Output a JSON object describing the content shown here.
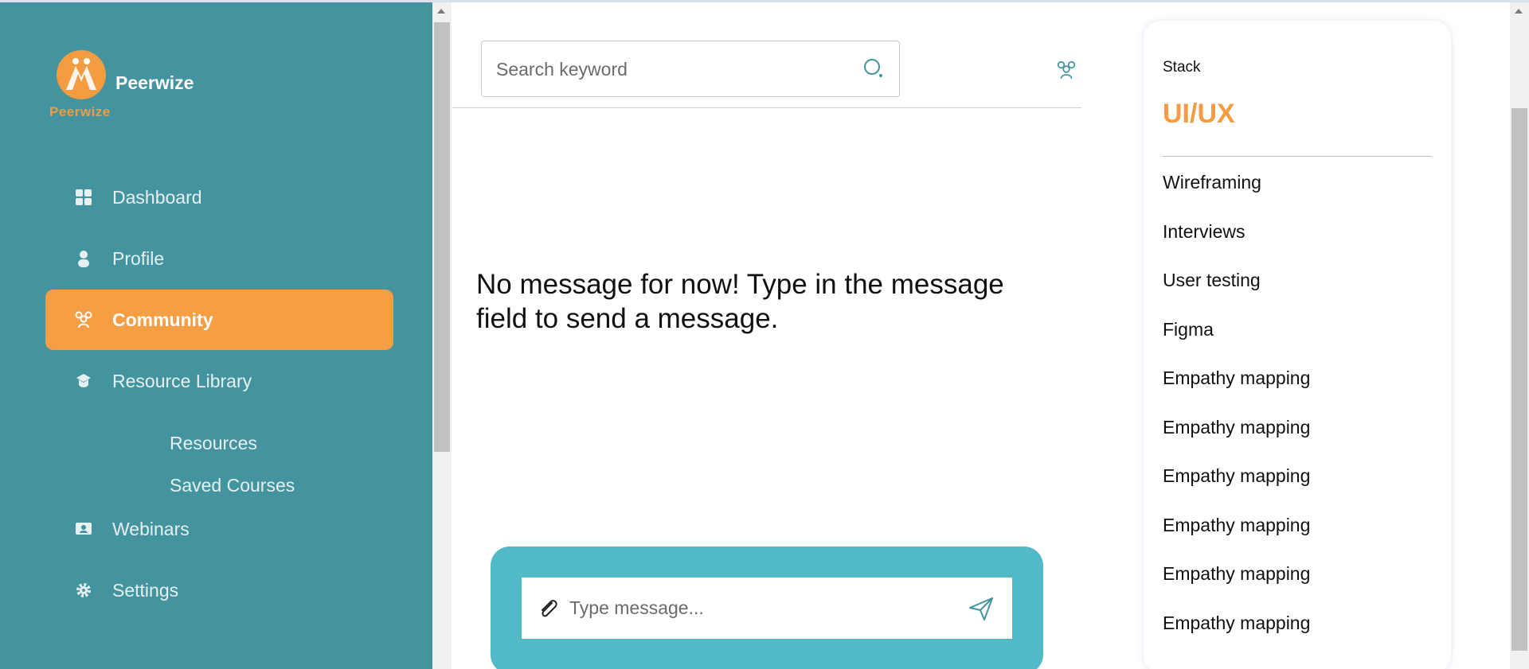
{
  "brand": {
    "name": "Peerwize",
    "logo_text": "Peerwize"
  },
  "sidebar": {
    "items": [
      {
        "label": "Dashboard",
        "icon": "grid-icon",
        "active": false
      },
      {
        "label": "Profile",
        "icon": "user-icon",
        "active": false
      },
      {
        "label": "Community",
        "icon": "group-icon",
        "active": true
      },
      {
        "label": "Resource Library",
        "icon": "graduation-cap-icon",
        "active": false
      },
      {
        "label": "Webinars",
        "icon": "monitor-user-icon",
        "active": false
      },
      {
        "label": "Settings",
        "icon": "gear-icon",
        "active": false
      }
    ],
    "subitems": [
      {
        "label": "Resources"
      },
      {
        "label": "Saved Courses"
      }
    ]
  },
  "chat": {
    "search_placeholder": "Search keyword",
    "empty_message": "No message for now! Type in the message field to send a message.",
    "message_placeholder": "Type message..."
  },
  "stack": {
    "label": "Stack",
    "title": "UI/UX",
    "topics": [
      "Wireframing",
      "Interviews",
      "User testing",
      "Figma",
      "Empathy mapping",
      "Empathy mapping",
      "Empathy mapping",
      "Empathy mapping",
      "Empathy mapping",
      "Empathy mapping"
    ]
  },
  "colors": {
    "sidebar_bg": "#43949f",
    "accent": "#f59e44",
    "composer_bg": "#52b9c6"
  }
}
